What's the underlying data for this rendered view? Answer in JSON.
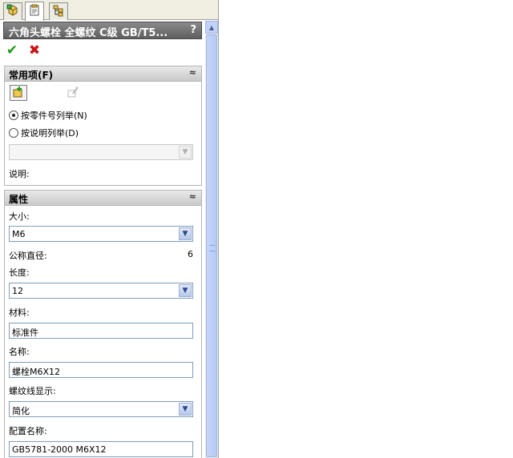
{
  "header": {
    "title": "六角头螺栓 全螺纹 C级 GB/T5...",
    "help": "?"
  },
  "tabs": [
    {
      "icon": "feature-manager-icon"
    },
    {
      "icon": "property-manager-icon"
    },
    {
      "icon": "configuration-manager-icon"
    }
  ],
  "actions": {
    "ok": "✔",
    "cancel": "✖"
  },
  "common": {
    "title": "常用项(F)",
    "collapse": "≈",
    "radio_part_number": "按零件号列举(N)",
    "radio_description": "按说明列举(D)",
    "dropdown_value": "",
    "description_label": "说明:"
  },
  "properties": {
    "title": "属性",
    "collapse": "≈",
    "size_label": "大小:",
    "size_value": "M6",
    "nominal_diameter_label": "公称直径:",
    "nominal_diameter_value": "6",
    "length_label": "长度:",
    "length_value": "12",
    "material_label": "材料:",
    "material_value": "标准件",
    "name_label": "名称:",
    "name_value": "螺栓M6X12",
    "thread_display_label": "螺纹线显示:",
    "thread_display_value": "简化",
    "config_name_label": "配置名称:",
    "config_name_value": "GB5781-2000 M6X12"
  },
  "colors": {
    "title_bg": "#6e6e6e",
    "ok": "#1a9a1a",
    "cancel": "#c81414",
    "field_border": "#7f9db9"
  }
}
